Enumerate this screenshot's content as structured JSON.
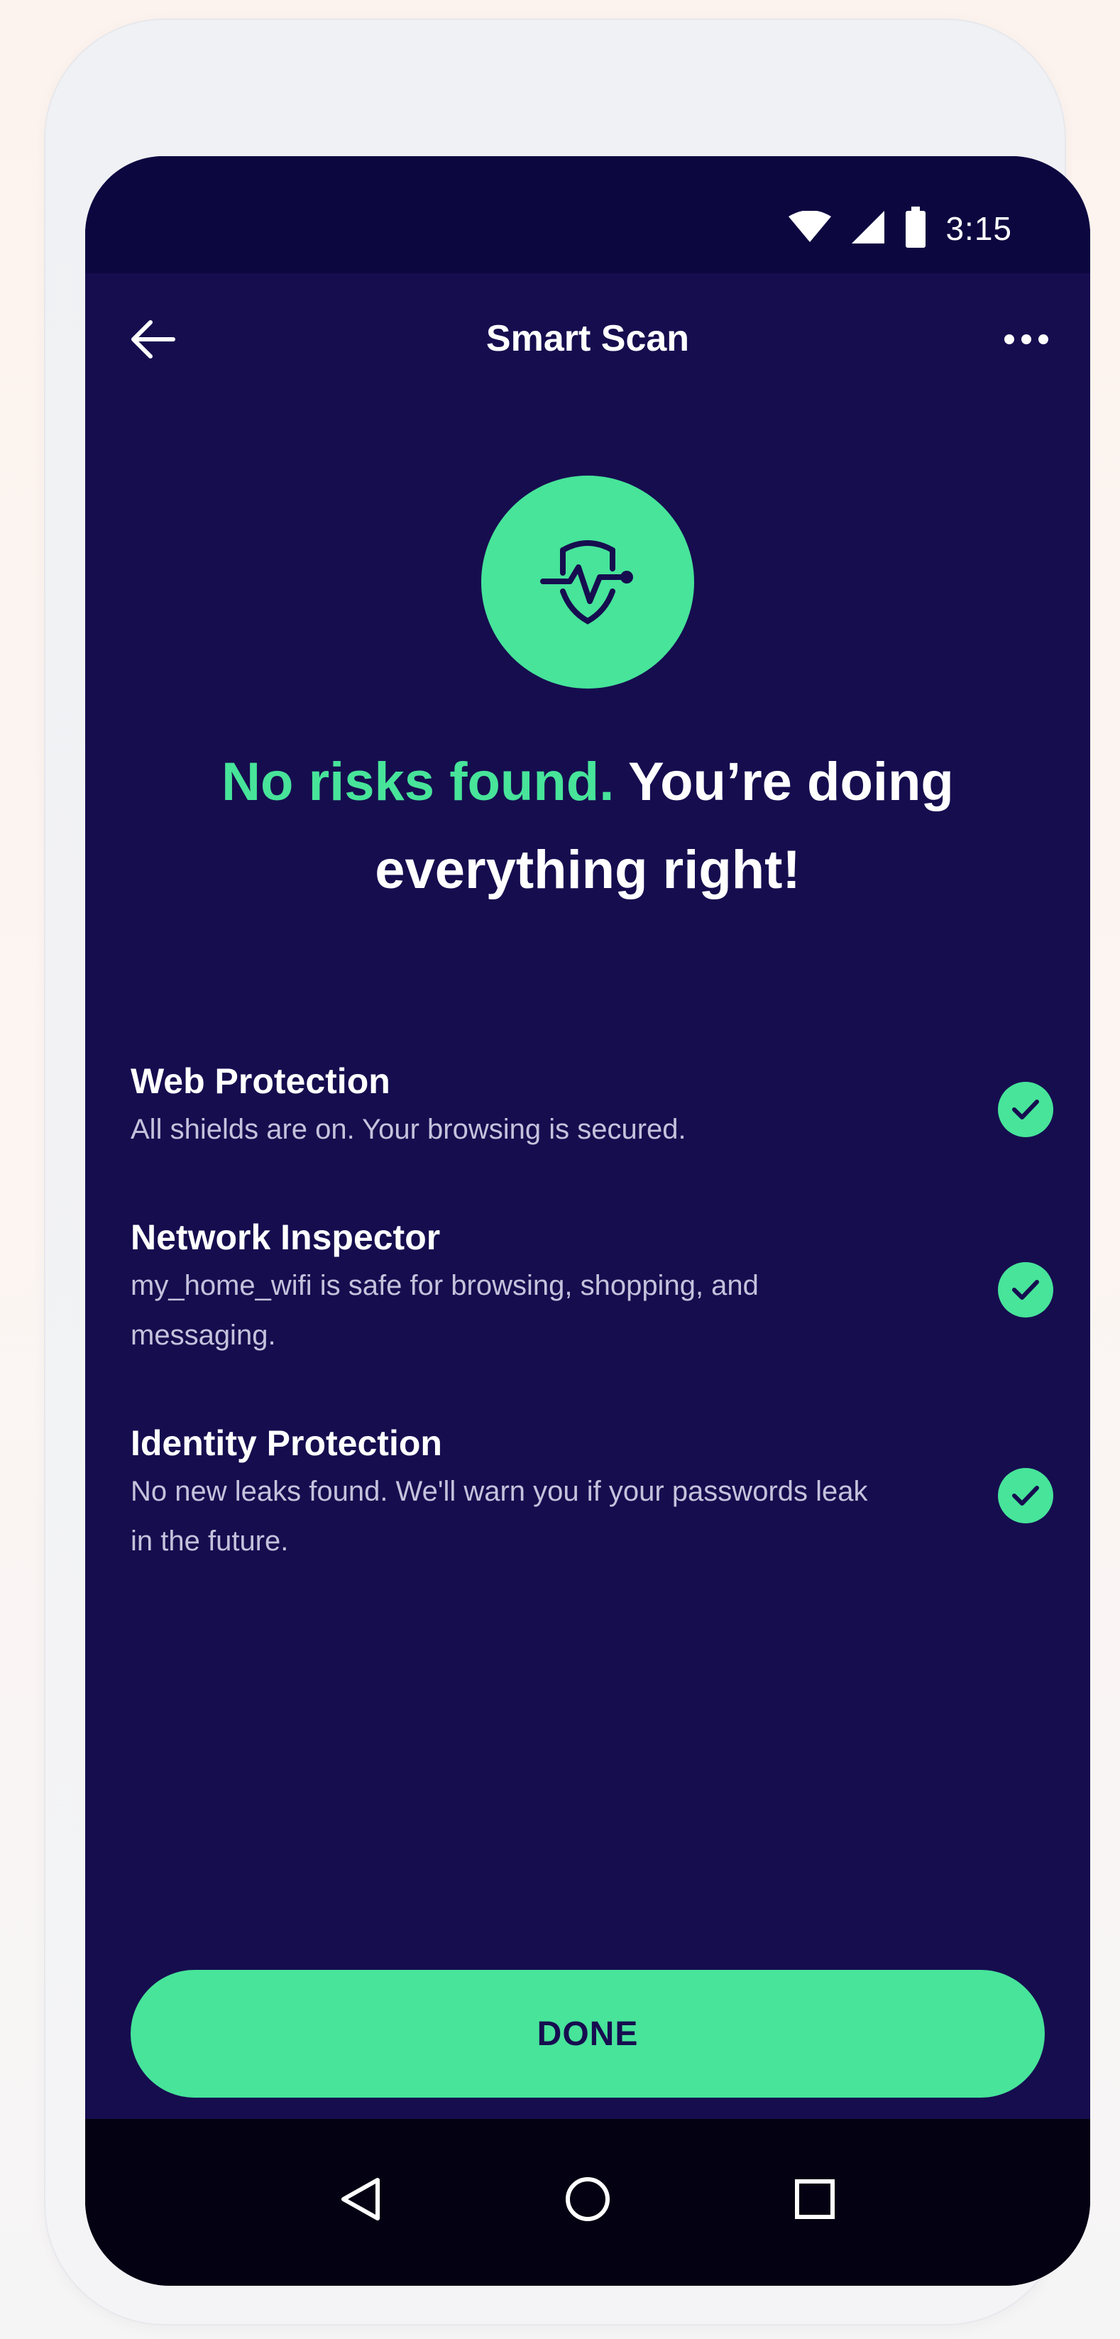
{
  "status_bar": {
    "time": "3:15",
    "icons": [
      "wifi-icon",
      "cellular-signal-icon",
      "battery-icon"
    ]
  },
  "app_bar": {
    "title": "Smart Scan",
    "back_icon": "arrow-left-icon",
    "more_icon": "more-horizontal-icon"
  },
  "hero": {
    "icon": "shield-pulse-icon",
    "headline_accent": "No risks found.",
    "headline_rest": " You’re doing everything right!"
  },
  "checks": [
    {
      "title": "Web Protection",
      "description": "All shields are on. Your browsing is secured.",
      "status_icon": "check-circle-icon"
    },
    {
      "title": "Network Inspector",
      "description": "my_home_wifi is safe for browsing, shopping, and messaging.",
      "status_icon": "check-circle-icon"
    },
    {
      "title": "Identity Protection",
      "description": "No new leaks found. We'll warn you if your passwords leak in the future.",
      "status_icon": "check-circle-icon"
    }
  ],
  "done_button": {
    "label": "DONE"
  },
  "nav_bar": {
    "icons": [
      "nav-back-triangle-icon",
      "nav-home-circle-icon",
      "nav-recents-square-icon"
    ]
  },
  "colors": {
    "accent": "#47e49a",
    "background": "#160d4f",
    "status_bar": "#0d0740",
    "nav_bar": "#030112",
    "text_secondary": "#c4c2dc"
  }
}
